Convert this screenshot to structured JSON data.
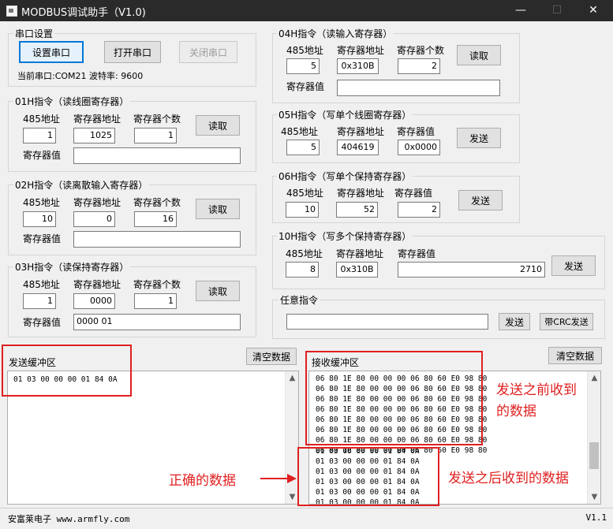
{
  "window": {
    "title": "MODBUS调试助手（V1.0)"
  },
  "serial": {
    "group": "串口设置",
    "set_btn": "设置串口",
    "open_btn": "打开串口",
    "close_btn": "关闭串口",
    "status": "当前串口:COM21 波特率: 9600"
  },
  "labels": {
    "addr485": "485地址",
    "regaddr": "寄存器地址",
    "regcount": "寄存器个数",
    "regval": "寄存器值",
    "read": "读取",
    "send": "发送"
  },
  "cmd01": {
    "title": "01H指令（读线圈寄存器）",
    "addr": "1",
    "reg": "1025",
    "count": "1",
    "value": ""
  },
  "cmd02": {
    "title": "02H指令（读离散输入寄存器）",
    "addr": "10",
    "reg": "0",
    "count": "16",
    "value": ""
  },
  "cmd03": {
    "title": "03H指令（读保持寄存器）",
    "addr": "1",
    "reg": "0000",
    "count": "1",
    "value": "0000 01"
  },
  "cmd04": {
    "title": "04H指令（读输入寄存器）",
    "addr": "5",
    "reg": "0x310B",
    "count": "2",
    "value": ""
  },
  "cmd05": {
    "title": "05H指令（写单个线圈寄存器）",
    "addr": "5",
    "reg": "404619",
    "value": "0x0000"
  },
  "cmd06": {
    "title": "06H指令（写单个保持寄存器）",
    "addr": "10",
    "reg": "52",
    "value": "2"
  },
  "cmd10": {
    "title": "10H指令（写多个保持寄存器）",
    "addr": "8",
    "reg": "0x310B",
    "value": "2710"
  },
  "any": {
    "title": "任意指令",
    "input": "",
    "send": "发送",
    "send_crc": "带CRC发送"
  },
  "sendbuf": {
    "title": "发送缓冲区",
    "clear": "清空数据",
    "lines": [
      "01 03 00 00 00 01 84 0A"
    ]
  },
  "recvbuf": {
    "title": "接收缓冲区",
    "clear": "清空数据",
    "lines_before": [
      "06 80 1E 80 00 00 00 06 80 60 E0 98 80",
      "06 80 1E 80 00 00 00 06 80 60 E0 98 80",
      "06 80 1E 80 00 00 00 06 80 60 E0 98 80",
      "06 80 1E 80 00 00 00 06 80 60 E0 98 80",
      "06 80 1E 80 00 00 00 06 80 60 E0 98 80",
      "06 80 1E 80 00 00 00 06 80 60 E0 98 80",
      "06 80 1E 80 00 00 00 06 80 60 E0 98 80",
      "06 80 1E 80 00 00 00 06 80 60 E0 98 80"
    ],
    "lines_after": [
      "01 03 00 00 00 01 84 0A",
      "01 03 00 00 00 01 84 0A",
      "01 03 00 00 00 01 84 0A",
      "01 03 00 00 00 01 84 0A",
      "01 03 00 00 00 01 84 0A",
      "01 03 00 00 00 01 84 0A"
    ]
  },
  "annotations": {
    "before_line1": "发送之前收到",
    "before_line2": "的数据",
    "after": "发送之后收到的数据",
    "correct": "正确的数据"
  },
  "status": {
    "left": "安富莱电子 www.armfly.com",
    "right": "V1.1"
  },
  "colors": {
    "annotation": "#e02020",
    "titlebar": "#2a2a2a",
    "focus": "#0078d7"
  }
}
